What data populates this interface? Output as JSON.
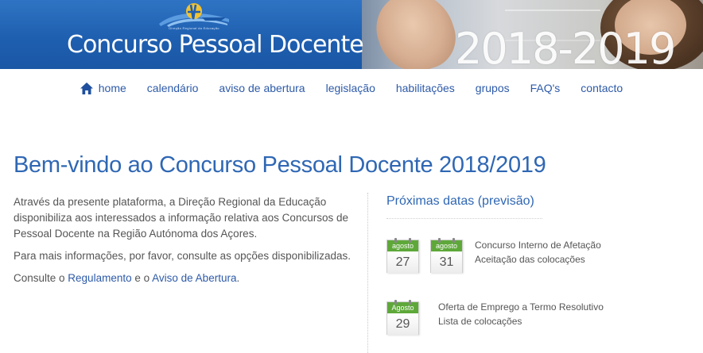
{
  "header": {
    "logo_caption": "Direção Regional da Educação",
    "title": "Concurso Pessoal Docente",
    "years": "2018-2019"
  },
  "nav": {
    "items": [
      {
        "label": "home"
      },
      {
        "label": "calendário"
      },
      {
        "label": "aviso de abertura"
      },
      {
        "label": "legislação"
      },
      {
        "label": "habilitações"
      },
      {
        "label": "grupos"
      },
      {
        "label": "FAQ's"
      },
      {
        "label": "contacto"
      }
    ]
  },
  "main": {
    "title": "Bem-vindo ao Concurso Pessoal Docente 2018/2019",
    "intro_p1": "Através da presente plataforma, a Direção Regional da Educação disponibiliza aos interessados a informação relativa aos Concursos de Pessoal Docente na Região Autónoma dos Açores.",
    "intro_p2": "Para mais informações, por favor, consulte as opções disponibilizadas.",
    "intro_p3_prefix": "Consulte o ",
    "intro_p3_link1": "Regulamento",
    "intro_p3_middle": " e o ",
    "intro_p3_link2": "Aviso de Abertura",
    "intro_p3_suffix": "."
  },
  "dates": {
    "title": "Próximas datas (previsão)",
    "calendars": [
      {
        "month": "agosto",
        "day": "27"
      },
      {
        "month": "agosto",
        "day": "31"
      },
      {
        "month": "Agosto",
        "day": "29"
      }
    ],
    "events": [
      {
        "line1": "Concurso Interno de Afetação",
        "line2": "Aceitação das colocações"
      },
      {
        "line1": "Oferta de Emprego a Termo Resolutivo",
        "line2": "Lista de colocações"
      }
    ]
  },
  "colors": {
    "banner_blue": "#1f5fb0",
    "link_blue": "#2d5aa8",
    "heading_blue": "#2f67b4",
    "calendar_green": "#5ea83a"
  }
}
